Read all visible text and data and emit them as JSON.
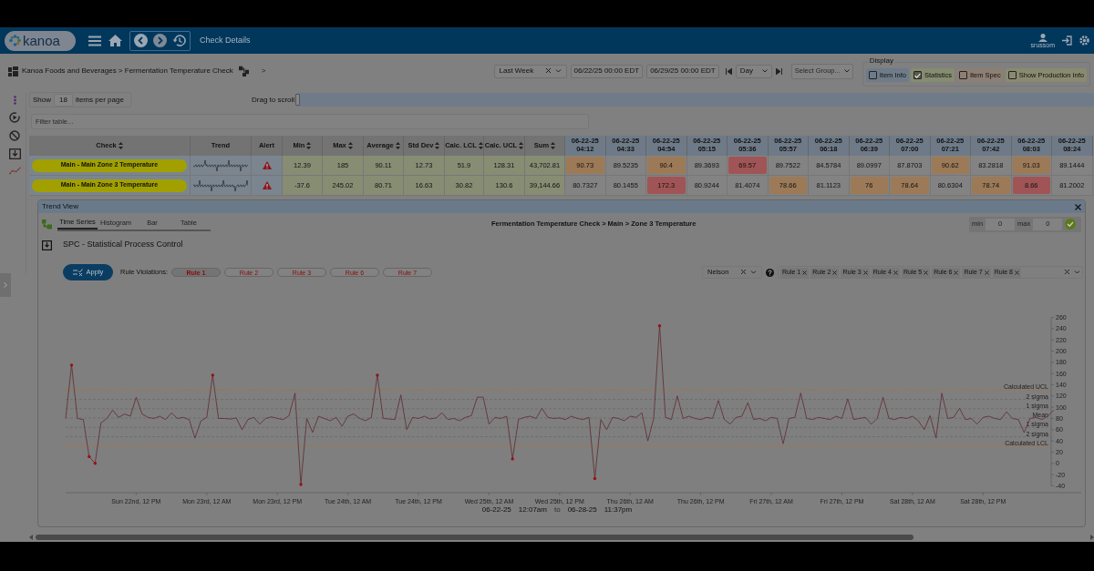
{
  "header": {
    "logo": "kanoa",
    "title": "Check Details",
    "user": "srussom"
  },
  "breadcrumb": {
    "path": "Kanoa Foods and Beverages > Fermentation Temperature Check",
    "chevron": ">"
  },
  "filters": {
    "range": "Last Week",
    "start": "06/22/25 00:00 EDT",
    "end": "06/29/25 00:00 EDT",
    "interval": "Day",
    "group": {
      "placeholder": "Select Group..."
    }
  },
  "display": {
    "title": "Display",
    "options": [
      {
        "label": "Item Info",
        "checked": false,
        "color": "#6e7b89"
      },
      {
        "label": "Statistics",
        "checked": true,
        "color": "#868c70"
      },
      {
        "label": "Item Spec",
        "checked": false,
        "color": "#8d7f74"
      },
      {
        "label": "Show Production Info",
        "checked": false,
        "color": "#8a8a70"
      }
    ]
  },
  "paging": {
    "show": "Show",
    "per_page": "18",
    "suffix": "items per page"
  },
  "drag_label": "Drag to scroll",
  "filter": {
    "placeholder": "Filter table..."
  },
  "table": {
    "columns": [
      {
        "label": "Check",
        "sortable": true,
        "kind": "check"
      },
      {
        "label": "Trend",
        "sortable": false,
        "kind": "trend"
      },
      {
        "label": "Alert",
        "sortable": false,
        "kind": "alert"
      },
      {
        "label": "Min",
        "sortable": true,
        "kind": "stat"
      },
      {
        "label": "Max",
        "sortable": true,
        "kind": "stat"
      },
      {
        "label": "Average",
        "sortable": true,
        "kind": "stat"
      },
      {
        "label": "Std Dev",
        "sortable": true,
        "kind": "stat"
      },
      {
        "label": "Calc. LCL",
        "sortable": true,
        "kind": "stat"
      },
      {
        "label": "Calc. UCL",
        "sortable": true,
        "kind": "stat"
      },
      {
        "label": "Sum",
        "sortable": true,
        "kind": "stat"
      },
      {
        "label": "06-22-25 04:12",
        "sortable": false,
        "kind": "reading"
      },
      {
        "label": "06-22-25 04:33",
        "sortable": false,
        "kind": "reading"
      },
      {
        "label": "06-22-25 04:54",
        "sortable": false,
        "kind": "reading"
      },
      {
        "label": "06-22-25 05:15",
        "sortable": false,
        "kind": "reading"
      },
      {
        "label": "06-22-25 05:36",
        "sortable": false,
        "kind": "reading"
      },
      {
        "label": "06-22-25 05:57",
        "sortable": false,
        "kind": "reading"
      },
      {
        "label": "06-22-25 06:18",
        "sortable": false,
        "kind": "reading"
      },
      {
        "label": "06-22-25 06:39",
        "sortable": false,
        "kind": "reading"
      },
      {
        "label": "06-22-25 07:00",
        "sortable": false,
        "kind": "reading"
      },
      {
        "label": "06-22-25 07:21",
        "sortable": false,
        "kind": "reading"
      },
      {
        "label": "06-22-25 07:42",
        "sortable": false,
        "kind": "reading"
      },
      {
        "label": "06-22-25 08:03",
        "sortable": false,
        "kind": "reading"
      },
      {
        "label": "06-22-25 08:24",
        "sortable": false,
        "kind": "reading"
      }
    ],
    "rows": [
      {
        "check": "Main - Main Zone 2 Temperature",
        "alert": true,
        "stats": [
          "12.39",
          "185",
          "90.11",
          "12.73",
          "51.9",
          "128.31",
          "43,702.81"
        ],
        "readings": [
          {
            "value": "90.73",
            "color": "#9c7a57"
          },
          {
            "value": "89.5235"
          },
          {
            "value": "90.4",
            "color": "#9c7a57"
          },
          {
            "value": "89.3693"
          },
          {
            "value": "69.57",
            "color": "#a05455"
          },
          {
            "value": "89.7522"
          },
          {
            "value": "84.5784"
          },
          {
            "value": "89.0997"
          },
          {
            "value": "87.8703"
          },
          {
            "value": "90.62",
            "color": "#9c7a57"
          },
          {
            "value": "83.2818"
          },
          {
            "value": "91.03",
            "color": "#9c7a57"
          },
          {
            "value": "89.1444"
          }
        ]
      },
      {
        "check": "Main - Main Zone 3 Temperature",
        "alert": true,
        "stats": [
          "-37.6",
          "245.02",
          "80.71",
          "16.63",
          "30.82",
          "130.6",
          "39,144.66"
        ],
        "readings": [
          {
            "value": "80.7327"
          },
          {
            "value": "80.1455"
          },
          {
            "value": "172.3",
            "color": "#a05455"
          },
          {
            "value": "80.9244"
          },
          {
            "value": "81.4074"
          },
          {
            "value": "78.66",
            "color": "#9c7a57"
          },
          {
            "value": "81.1123"
          },
          {
            "value": "76",
            "color": "#9c7a57"
          },
          {
            "value": "78.64",
            "color": "#9c7a57"
          },
          {
            "value": "80.6304"
          },
          {
            "value": "78.74",
            "color": "#9c7a57"
          },
          {
            "value": "8.66",
            "color": "#a05455"
          },
          {
            "value": "81.2002"
          }
        ]
      }
    ]
  },
  "trend_view": {
    "title": "Trend View",
    "tabs": [
      {
        "label": "Time Series",
        "selected": true
      },
      {
        "label": "Histogram",
        "selected": false
      },
      {
        "label": "Bar",
        "selected": false
      },
      {
        "label": "Table",
        "selected": false
      }
    ],
    "heading": "Fermentation Temperature Check > Main > Zone 3 Temperature",
    "min_label": "min",
    "min": "0",
    "max_label": "max",
    "max": "0",
    "section_title": "SPC - Statistical Process Control",
    "apply": "Apply",
    "violations_label": "Rule Violations:",
    "violations": [
      {
        "label": "Rule 1",
        "selected": true
      },
      {
        "label": "Rule 2",
        "selected": false
      },
      {
        "label": "Rule 3",
        "selected": false
      },
      {
        "label": "Rule 6",
        "selected": false
      },
      {
        "label": "Rule 7",
        "selected": false
      }
    ],
    "rule_set": "Nelson",
    "rules": [
      "Rule 1",
      "Rule 2",
      "Rule 3",
      "Rule 4",
      "Rule 5",
      "Rule 6",
      "Rule 7",
      "Rule 8"
    ],
    "chart_data": {
      "type": "line",
      "ylim": [
        -40,
        260
      ],
      "yticks": [
        -40,
        -20,
        0,
        20,
        40,
        60,
        80,
        100,
        120,
        140,
        160,
        180,
        200,
        220,
        240,
        260
      ],
      "categories": [
        null,
        null,
        null,
        null,
        null,
        null,
        null,
        null,
        null,
        null,
        null,
        null,
        "Sun 22nd, 12 PM",
        null,
        null,
        null,
        null,
        null,
        null,
        null,
        null,
        null,
        null,
        null,
        "Mon 23rd, 12 AM",
        null,
        null,
        null,
        null,
        null,
        null,
        null,
        null,
        null,
        null,
        null,
        "Mon 23rd, 12 PM",
        null,
        null,
        null,
        null,
        null,
        null,
        null,
        null,
        null,
        null,
        null,
        "Tue 24th, 12 AM",
        null,
        null,
        null,
        null,
        null,
        null,
        null,
        null,
        null,
        null,
        null,
        "Tue 24th, 12 PM",
        null,
        null,
        null,
        null,
        null,
        null,
        null,
        null,
        null,
        null,
        null,
        "Wed 25th, 12 AM",
        null,
        null,
        null,
        null,
        null,
        null,
        null,
        null,
        null,
        null,
        null,
        "Wed 25th, 12 PM",
        null,
        null,
        null,
        null,
        null,
        null,
        null,
        null,
        null,
        null,
        null,
        "Thu 26th, 12 AM",
        null,
        null,
        null,
        null,
        null,
        null,
        null,
        null,
        null,
        null,
        null,
        "Thu 26th, 12 PM",
        null,
        null,
        null,
        null,
        null,
        null,
        null,
        null,
        null,
        null,
        null,
        "Fri 27th, 12 AM",
        null,
        null,
        null,
        null,
        null,
        null,
        null,
        null,
        null,
        null,
        null,
        "Fri 27th, 12 PM",
        null,
        null,
        null,
        null,
        null,
        null,
        null,
        null,
        null,
        null,
        null,
        "Sat 28th, 12 AM",
        null,
        null,
        null,
        null,
        null,
        null,
        null,
        null,
        null,
        null,
        null,
        "Sat 28th, 12 PM",
        null,
        null,
        null,
        null,
        null,
        null,
        null,
        null,
        null,
        null,
        null,
        null
      ],
      "series": [
        {
          "color": "#5e2a32",
          "values": [
            80,
            175,
            80,
            78,
            12,
            0,
            72,
            80,
            95,
            82,
            88,
            84,
            118,
            88,
            82,
            80,
            84,
            78,
            90,
            80,
            82,
            78,
            45,
            76,
            82,
            157,
            80,
            80,
            79,
            81,
            60,
            78,
            82,
            70,
            80,
            83,
            80,
            78,
            85,
            125,
            -37.6,
            80,
            55,
            84,
            80,
            76,
            82,
            66,
            84,
            88,
            80,
            76,
            82,
            157,
            80,
            79,
            78,
            122,
            60,
            82,
            80,
            84,
            79,
            81,
            90,
            78,
            80,
            76,
            82,
            85,
            118,
            118,
            70,
            82,
            80,
            84,
            8,
            78,
            82,
            84,
            80,
            98,
            82,
            80,
            81,
            78,
            84,
            80,
            78,
            82,
            -27,
            78,
            60,
            82,
            80,
            76,
            84,
            82,
            90,
            40,
            80,
            245.02,
            82,
            78,
            120,
            80,
            84,
            80,
            78,
            82,
            80,
            112,
            78,
            70,
            82,
            84,
            108,
            78,
            80,
            76,
            82,
            80,
            35,
            80,
            82,
            125,
            80,
            78,
            82,
            80,
            78,
            84,
            80,
            115,
            78,
            80,
            82,
            70,
            80,
            118,
            80,
            78,
            82,
            80,
            84,
            76,
            60,
            85,
            45,
            125,
            80,
            82,
            98,
            78,
            80,
            70,
            82,
            84,
            80,
            78,
            92,
            80,
            78,
            55,
            80,
            82,
            78,
            84,
            95
          ]
        }
      ],
      "ref_lines": [
        {
          "axis": "y",
          "value": 130.6,
          "label": "Calculated UCL",
          "color": "#b0702c"
        },
        {
          "axis": "y",
          "value": 113.97,
          "label": "2 sigma",
          "color": "#6a6a6a"
        },
        {
          "axis": "y",
          "value": 97.34,
          "label": "1 sigma",
          "color": "#6a6a6a"
        },
        {
          "axis": "y",
          "value": 80.71,
          "label": "Mean",
          "color": "#6a6a6a"
        },
        {
          "axis": "y",
          "value": 64.08,
          "label": "1 sigma",
          "color": "#6a6a6a"
        },
        {
          "axis": "y",
          "value": 47.45,
          "label": "2 sigma",
          "color": "#6a6a6a"
        },
        {
          "axis": "y",
          "value": 30.82,
          "label": "Calculated LCL",
          "color": "#b0702c"
        }
      ]
    },
    "range": {
      "from_date": "06-22-25",
      "from_time": "12:07am",
      "to": "to",
      "to_date": "06-28-25",
      "to_time": "11:37pm"
    }
  }
}
